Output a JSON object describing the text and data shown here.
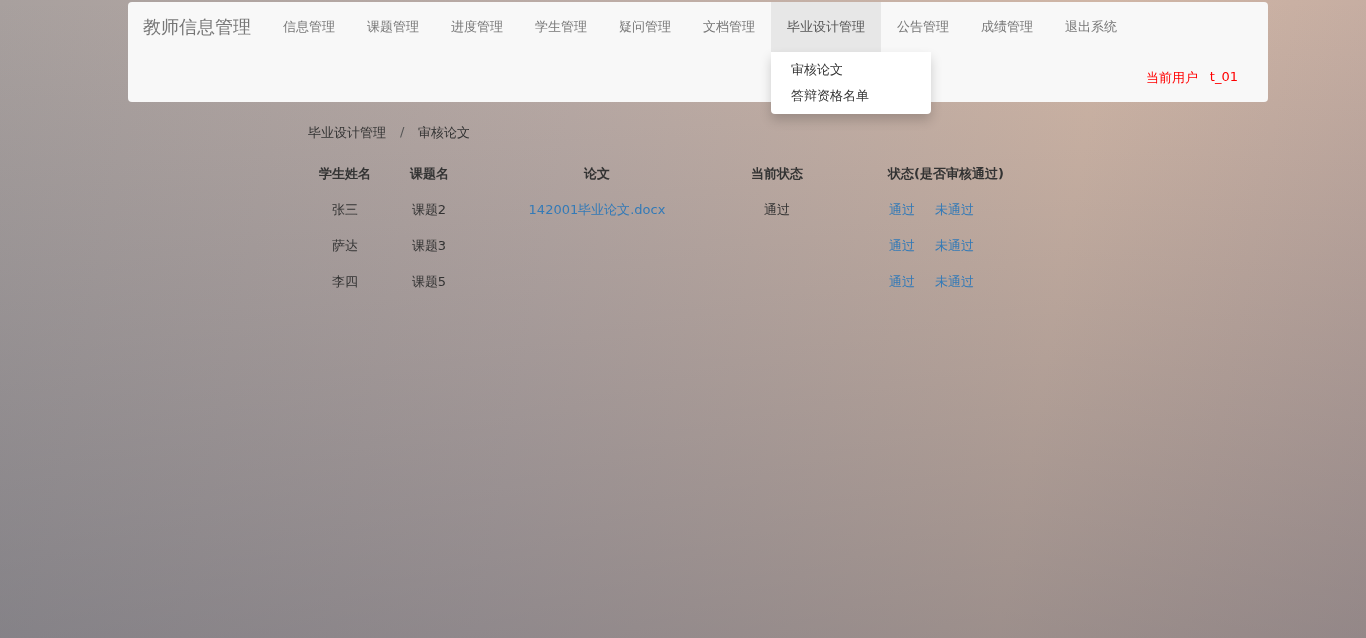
{
  "navbar": {
    "brand": "教师信息管理",
    "items": [
      {
        "label": "信息管理",
        "selected": false
      },
      {
        "label": "课题管理",
        "selected": false
      },
      {
        "label": "进度管理",
        "selected": false
      },
      {
        "label": "学生管理",
        "selected": false
      },
      {
        "label": "疑问管理",
        "selected": false
      },
      {
        "label": "文档管理",
        "selected": false
      },
      {
        "label": "毕业设计管理",
        "selected": true,
        "dropdown": [
          "审核论文",
          "答辩资格名单"
        ]
      },
      {
        "label": "公告管理",
        "selected": false
      },
      {
        "label": "成绩管理",
        "selected": false
      },
      {
        "label": "退出系统",
        "selected": false
      }
    ],
    "user_label": "当前用户",
    "user": "t_01"
  },
  "breadcrumb": {
    "items": [
      "毕业设计管理",
      "审核论文"
    ],
    "separator": "/"
  },
  "table": {
    "columns": [
      "学生姓名",
      "课题名",
      "论文",
      "当前状态",
      "状态(是否审核通过)"
    ],
    "rows": [
      {
        "name": "张三",
        "topic": "课题2",
        "paper": "142001毕业论文.docx",
        "status": "通过",
        "actions": [
          "通过",
          "未通过"
        ]
      },
      {
        "name": "萨达",
        "topic": "课题3",
        "actions": [
          "通过",
          "未通过"
        ]
      },
      {
        "name": "李四",
        "topic": "课题5",
        "actions": [
          "通过",
          "未通过"
        ]
      }
    ]
  }
}
